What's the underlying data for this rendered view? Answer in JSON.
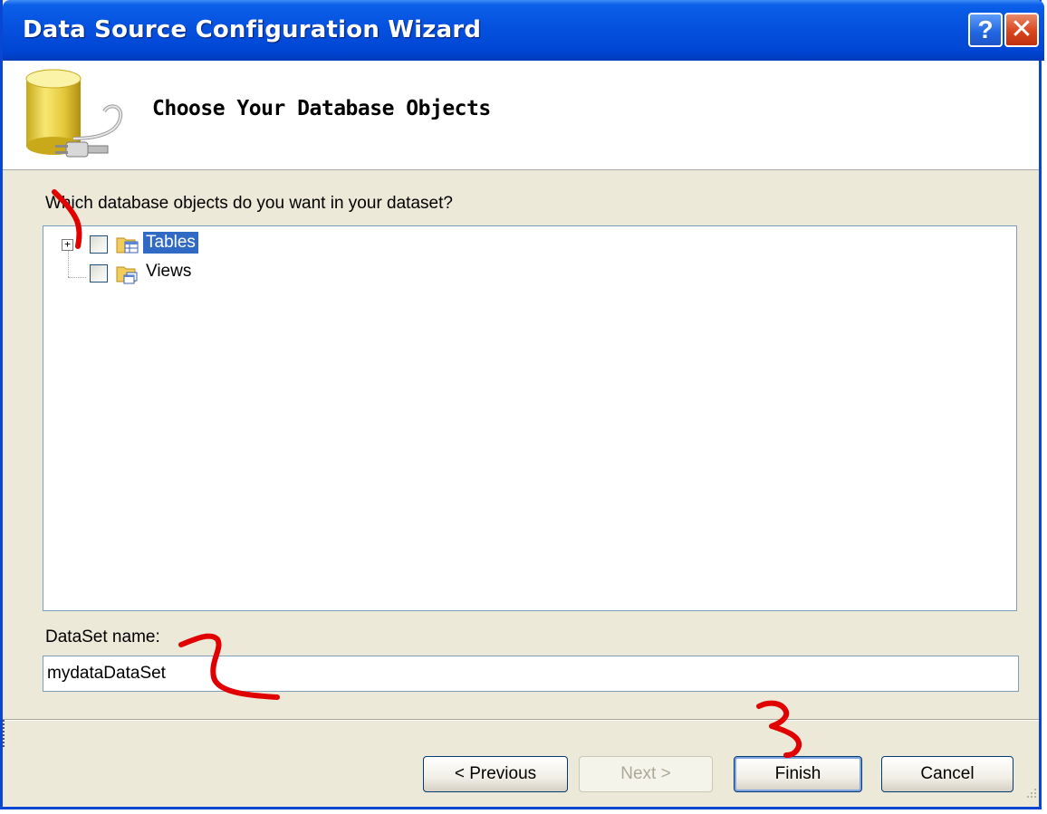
{
  "window": {
    "title": "Data Source Configuration Wizard",
    "help_glyph": "?",
    "close_glyph": "✕"
  },
  "banner": {
    "title": "Choose Your Database Objects",
    "icon": "database-plug-icon"
  },
  "prompt": "Which database objects do you want in your dataset?",
  "tree": {
    "items": [
      {
        "label": "Tables",
        "expander": "+",
        "checked": false,
        "selected": true
      },
      {
        "label": "Views",
        "checked": false,
        "selected": false
      }
    ]
  },
  "dataset": {
    "label": "DataSet name:",
    "value": "mydataDataSet"
  },
  "buttons": {
    "previous": "< Previous",
    "next": "Next >",
    "finish": "Finish",
    "cancel": "Cancel"
  },
  "annotations": {
    "color": "#e00000"
  },
  "colors": {
    "titlebar": "#0653e0",
    "selection": "#316ac5",
    "dialog_bg": "#ece9d8"
  }
}
